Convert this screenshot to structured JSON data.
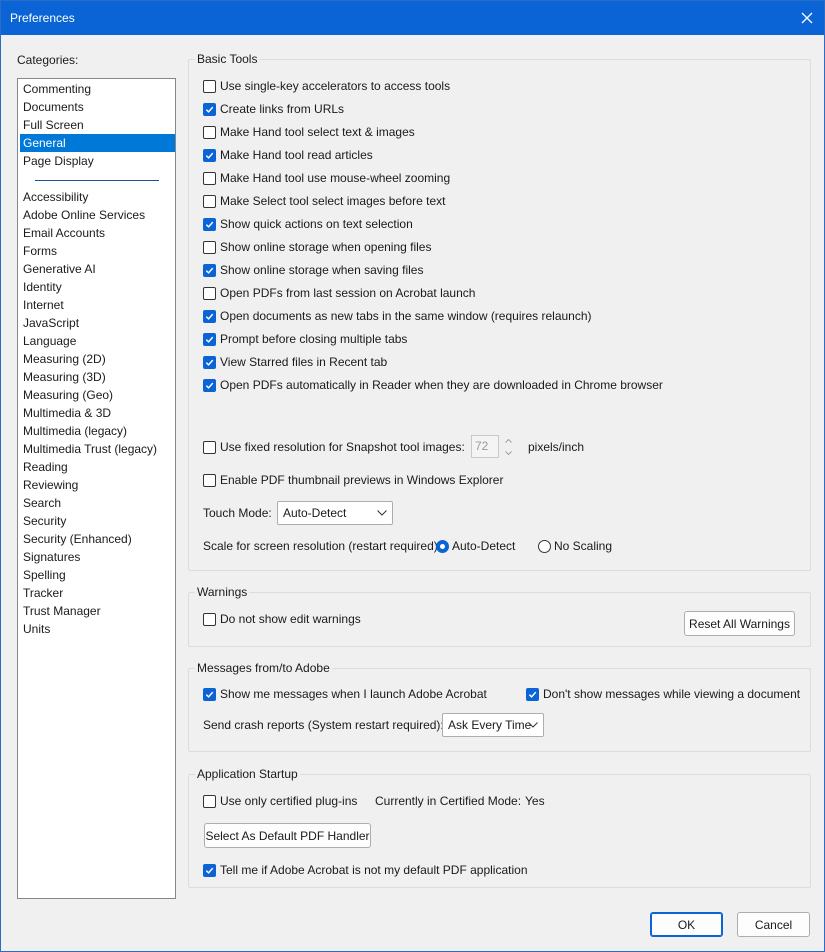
{
  "window": {
    "title": "Preferences"
  },
  "categories": {
    "label": "Categories:",
    "top": [
      "Commenting",
      "Documents",
      "Full Screen",
      "General",
      "Page Display"
    ],
    "selected": "General",
    "bottom": [
      "Accessibility",
      "Adobe Online Services",
      "Email Accounts",
      "Forms",
      "Generative AI",
      "Identity",
      "Internet",
      "JavaScript",
      "Language",
      "Measuring (2D)",
      "Measuring (3D)",
      "Measuring (Geo)",
      "Multimedia & 3D",
      "Multimedia (legacy)",
      "Multimedia Trust (legacy)",
      "Reading",
      "Reviewing",
      "Search",
      "Security",
      "Security (Enhanced)",
      "Signatures",
      "Spelling",
      "Tracker",
      "Trust Manager",
      "Units"
    ]
  },
  "basic_tools": {
    "title": "Basic Tools",
    "options": [
      {
        "label": "Use single-key accelerators to access tools",
        "checked": false
      },
      {
        "label": "Create links from URLs",
        "checked": true
      },
      {
        "label": "Make Hand tool select text & images",
        "checked": false
      },
      {
        "label": "Make Hand tool read articles",
        "checked": true
      },
      {
        "label": "Make Hand tool use mouse-wheel zooming",
        "checked": false
      },
      {
        "label": "Make Select tool select images before text",
        "checked": false
      },
      {
        "label": "Show quick actions on text selection",
        "checked": true
      },
      {
        "label": "Show online storage when opening files",
        "checked": false
      },
      {
        "label": "Show online storage when saving files",
        "checked": true
      },
      {
        "label": "Open PDFs from last session on Acrobat launch",
        "checked": false
      },
      {
        "label": "Open documents as new tabs in the same window (requires relaunch)",
        "checked": true
      },
      {
        "label": "Prompt before closing multiple tabs",
        "checked": true
      },
      {
        "label": "View Starred files in Recent tab",
        "checked": true
      },
      {
        "label": "Open PDFs automatically in Reader when they are downloaded in Chrome browser",
        "checked": true
      }
    ],
    "fixed_resolution": {
      "label": "Use fixed resolution for Snapshot tool images:",
      "checked": false,
      "value": "72",
      "unit": "pixels/inch"
    },
    "thumbnail": {
      "label": "Enable PDF thumbnail previews in Windows Explorer",
      "checked": false
    },
    "touch_mode": {
      "label": "Touch Mode:",
      "value": "Auto-Detect"
    },
    "scale": {
      "label": "Scale for screen resolution (restart required):",
      "option_auto": "Auto-Detect",
      "option_none": "No Scaling",
      "selected": "Auto-Detect"
    }
  },
  "warnings": {
    "title": "Warnings",
    "no_edit": {
      "label": "Do not show edit warnings",
      "checked": false
    },
    "reset_button": "Reset All Warnings"
  },
  "messages": {
    "title": "Messages from/to Adobe",
    "show_launch": {
      "label": "Show me messages when I launch Adobe Acrobat",
      "checked": true
    },
    "dont_show_viewing": {
      "label": "Don't show messages while viewing a document",
      "checked": true
    },
    "crash_label": "Send crash reports (System restart required):",
    "crash_value": "Ask Every Time"
  },
  "startup": {
    "title": "Application Startup",
    "certified": {
      "label": "Use only certified plug-ins",
      "checked": false
    },
    "mode_label": "Currently in Certified Mode:",
    "mode_value": "Yes",
    "default_handler_button": "Select As Default PDF Handler",
    "tell_me": {
      "label": "Tell me if Adobe Acrobat is not my default PDF application",
      "checked": true
    }
  },
  "footer": {
    "ok": "OK",
    "cancel": "Cancel"
  },
  "colors": {
    "accent": "#0a64d6",
    "selection": "#0078d7",
    "window_bg": "#f0f0f0"
  }
}
